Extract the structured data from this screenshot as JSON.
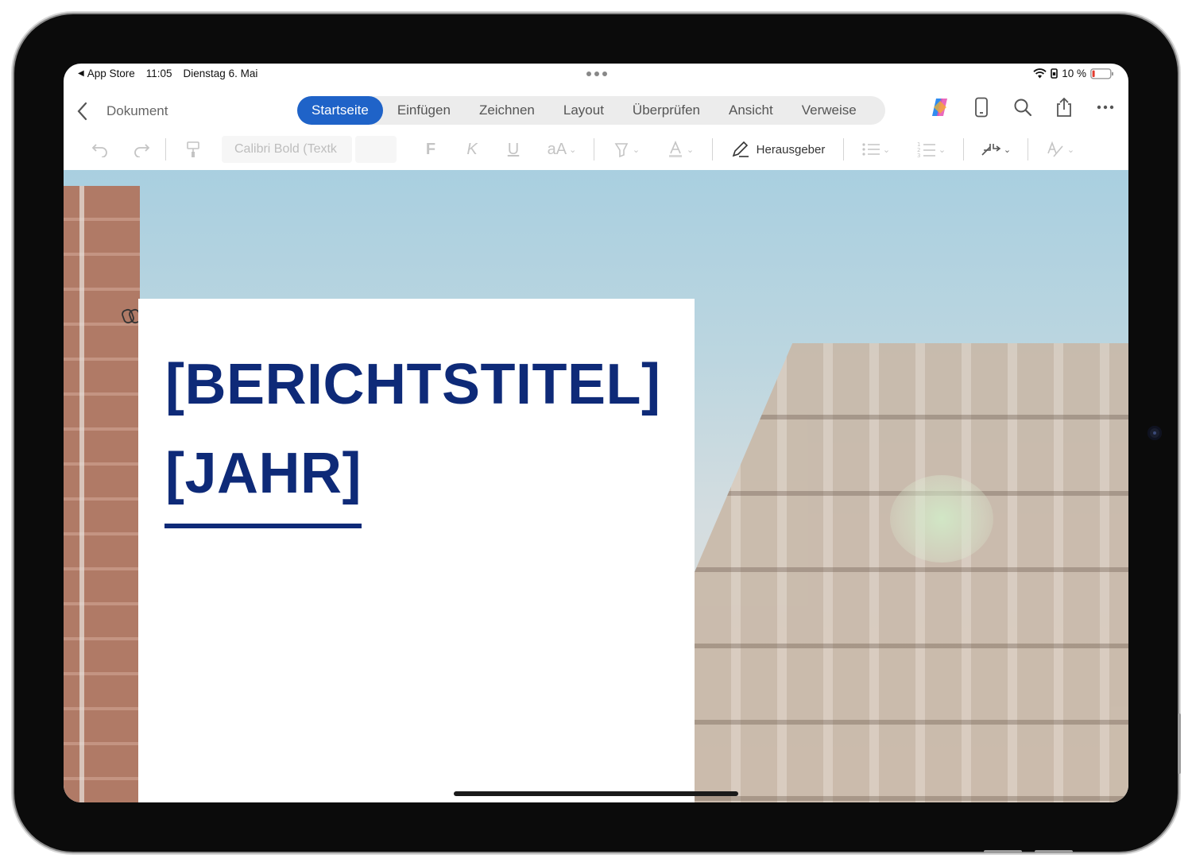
{
  "status": {
    "back_app": "App Store",
    "time": "11:05",
    "date": "Dienstag 6. Mai",
    "battery": "10 %"
  },
  "titlebar": {
    "back_icon": "chevron-left-icon",
    "document_name": "Dokument",
    "tabs": [
      {
        "label": "Startseite",
        "active": true
      },
      {
        "label": "Einfügen",
        "active": false
      },
      {
        "label": "Zeichnen",
        "active": false
      },
      {
        "label": "Layout",
        "active": false
      },
      {
        "label": "Überprüfen",
        "active": false
      },
      {
        "label": "Ansicht",
        "active": false
      },
      {
        "label": "Verweise",
        "active": false
      }
    ],
    "right_icons": [
      "copilot-icon",
      "phone-view-icon",
      "search-icon",
      "share-icon",
      "more-icon"
    ]
  },
  "toolbar": {
    "font_name": "Calibri Bold (Textk",
    "font_size": "",
    "bold": "F",
    "italic": "K",
    "underline": "U",
    "text_size": "aA",
    "editor_label": "Herausgeber"
  },
  "document": {
    "title_line1": "[BERICHTSTITEL]",
    "title_line2": "[JAHR]",
    "accent_color": "#0e2a78"
  },
  "colors": {
    "active_tab": "#1f63c8"
  }
}
